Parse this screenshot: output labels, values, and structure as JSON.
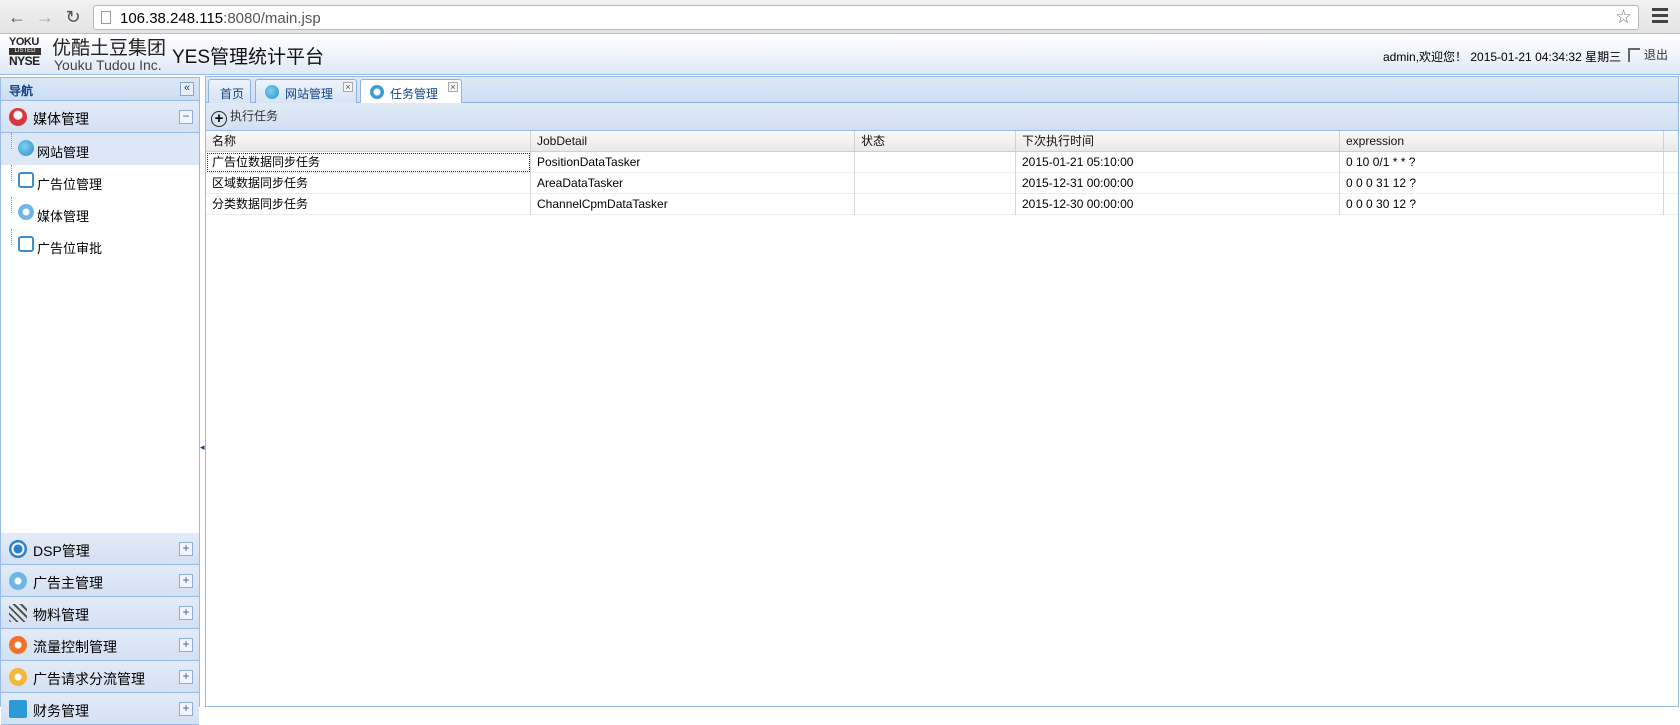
{
  "browser": {
    "url_host": "106.38.248.115",
    "url_rest": ":8080/main.jsp"
  },
  "header": {
    "logo_line1": "YOKU",
    "logo_line2": "LISTED",
    "logo_line3": "NYSE",
    "logo_cn": "优酷土豆集团",
    "logo_en": "Youku Tudou Inc.",
    "app_title": "YES管理统计平台",
    "user_info": "admin,欢迎您！ 2015-01-21 04:34:32 星期三",
    "logout": "退出"
  },
  "sidebar": {
    "title": "导航",
    "collapse_symbol": "«",
    "open_group": {
      "label": "媒体管理",
      "toggle": "−"
    },
    "items": [
      {
        "label": "网站管理"
      },
      {
        "label": "广告位管理"
      },
      {
        "label": "媒体管理"
      },
      {
        "label": "广告位审批"
      }
    ],
    "groups": [
      {
        "label": "DSP管理",
        "toggle": "+"
      },
      {
        "label": "广告主管理",
        "toggle": "+"
      },
      {
        "label": "物料管理",
        "toggle": "+"
      },
      {
        "label": "流量控制管理",
        "toggle": "+"
      },
      {
        "label": "广告请求分流管理",
        "toggle": "+"
      },
      {
        "label": "财务管理",
        "toggle": "+"
      }
    ]
  },
  "tabs": [
    {
      "label": "首页"
    },
    {
      "label": "网站管理"
    },
    {
      "label": "任务管理"
    }
  ],
  "toolbar": {
    "run_task": "执行任务"
  },
  "grid": {
    "columns": [
      "名称",
      "JobDetail",
      "状态",
      "下次执行时间",
      "expression"
    ],
    "rows": [
      [
        "广告位数据同步任务",
        "PositionDataTasker",
        "",
        "2015-01-21 05:10:00",
        "0 10 0/1 * * ?"
      ],
      [
        "区域数据同步任务",
        "AreaDataTasker",
        "",
        "2015-12-31 00:00:00",
        "0 0 0 31 12 ?"
      ],
      [
        "分类数据同步任务",
        "ChannelCpmDataTasker",
        "",
        "2015-12-30 00:00:00",
        "0 0 0 30 12 ?"
      ]
    ]
  },
  "colors": {
    "panel_border": "#99bbe8",
    "header_text": "#15428b"
  }
}
